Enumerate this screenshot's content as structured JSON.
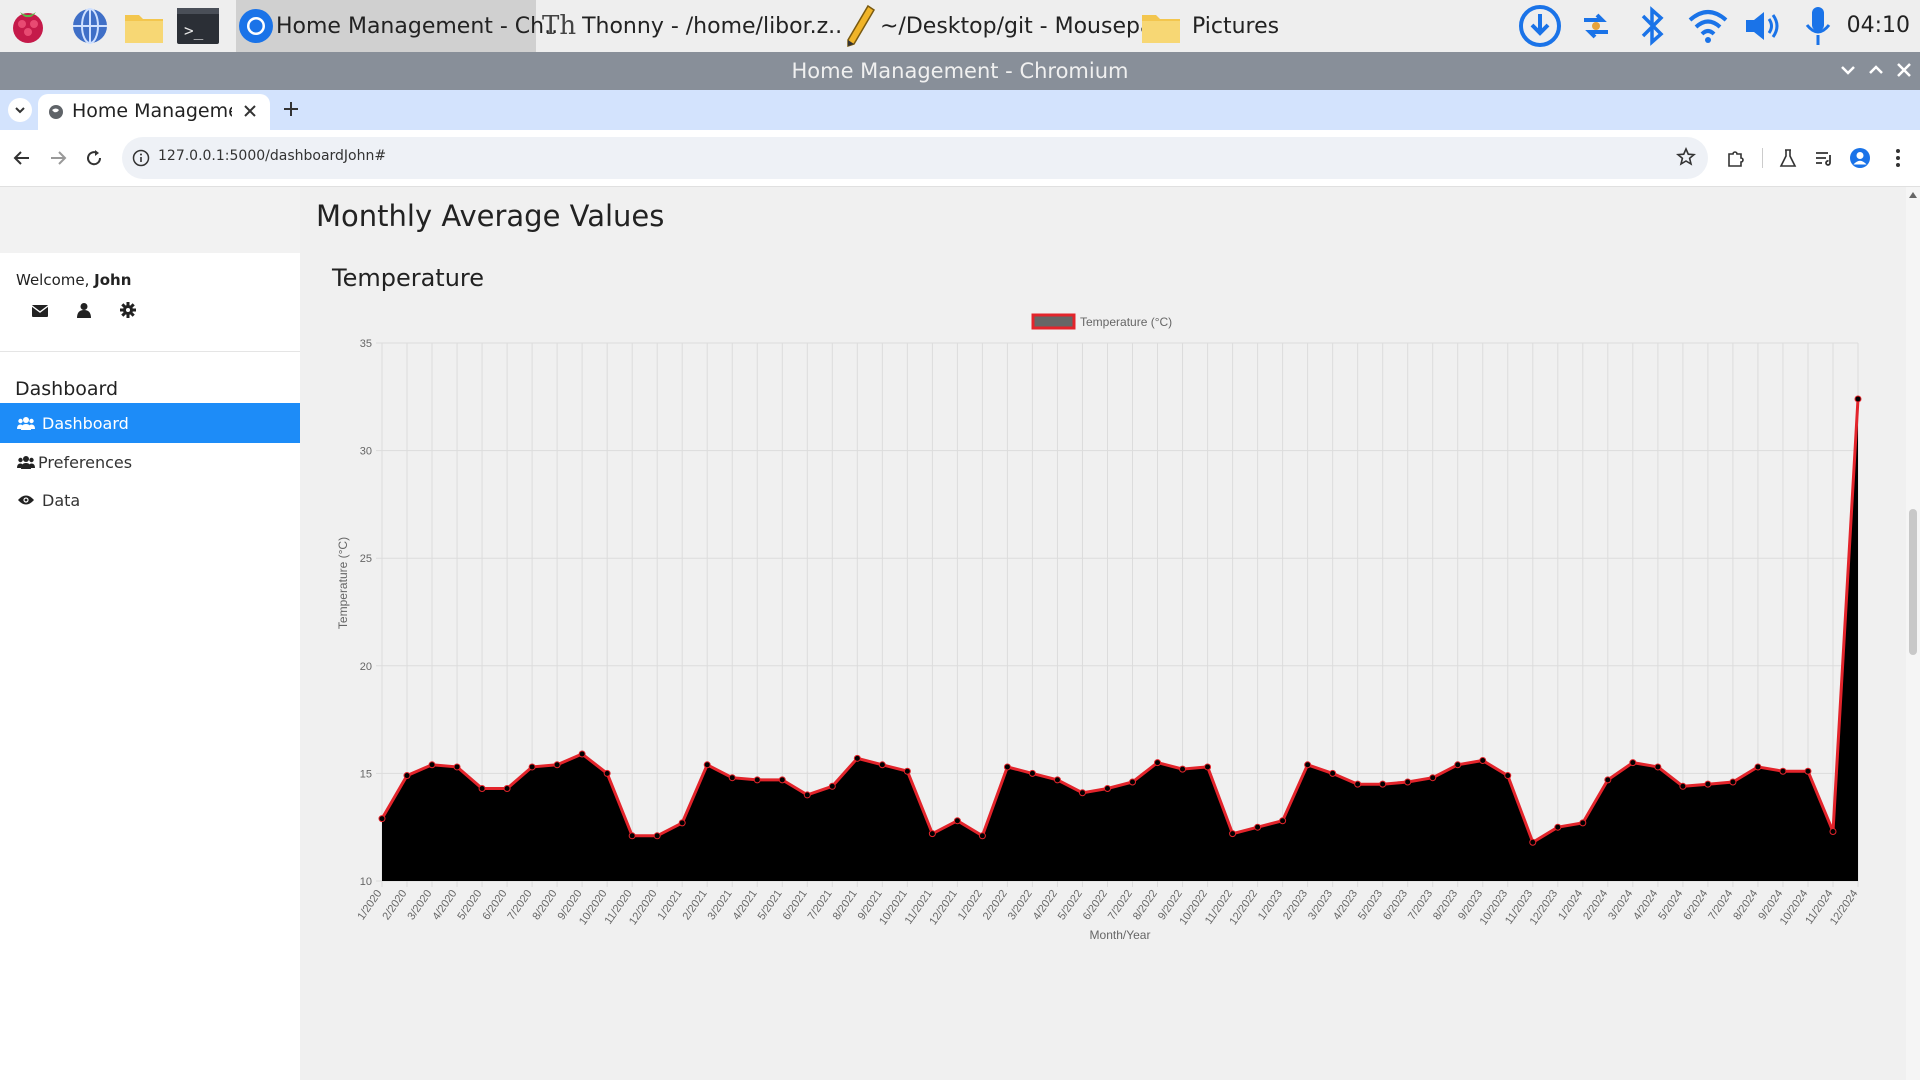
{
  "taskbar": {
    "items": [
      {
        "label": "Home Management - Ch..",
        "icon": "chromium-icon"
      },
      {
        "label": "Thonny  -  /home/libor.z..",
        "icon": "thonny-icon"
      },
      {
        "label": "~/Desktop/git - Mousepa..",
        "icon": "pencil-icon"
      },
      {
        "label": "Pictures",
        "icon": "folder-icon"
      }
    ],
    "clock": "04:10"
  },
  "window": {
    "title": "Home Management - Chromium"
  },
  "browser": {
    "tab_title": "Home Management",
    "url": "127.0.0.1:5000/dashboardJohn#"
  },
  "sidebar": {
    "welcome_prefix": "Welcome,",
    "user_name": "John",
    "section_title": "Dashboard",
    "items": [
      {
        "label": "Dashboard",
        "icon": "users-icon",
        "active": true
      },
      {
        "label": "Preferences",
        "icon": "users-icon",
        "active": false
      },
      {
        "label": "Data",
        "icon": "eye-icon",
        "active": false
      }
    ]
  },
  "main": {
    "page_title": "Monthly Average Values",
    "card_title": "Temperature"
  },
  "chart_data": {
    "type": "area",
    "title": "",
    "legend": "Temperature (°C)",
    "legend_position": "top-center",
    "xlabel": "Month/Year",
    "ylabel": "Temperature (°C)",
    "ylim": [
      10,
      35
    ],
    "yticks": [
      10,
      15,
      20,
      25,
      30,
      35
    ],
    "grid": true,
    "line_color": "#e3242b",
    "fill_color": "#000000",
    "categories": [
      "1/2020",
      "2/2020",
      "3/2020",
      "4/2020",
      "5/2020",
      "6/2020",
      "7/2020",
      "8/2020",
      "9/2020",
      "10/2020",
      "11/2020",
      "12/2020",
      "1/2021",
      "2/2021",
      "3/2021",
      "4/2021",
      "5/2021",
      "6/2021",
      "7/2021",
      "8/2021",
      "9/2021",
      "10/2021",
      "11/2021",
      "12/2021",
      "1/2022",
      "2/2022",
      "3/2022",
      "4/2022",
      "5/2022",
      "6/2022",
      "7/2022",
      "8/2022",
      "9/2022",
      "10/2022",
      "11/2022",
      "12/2022",
      "1/2023",
      "2/2023",
      "3/2023",
      "4/2023",
      "5/2023",
      "6/2023",
      "7/2023",
      "8/2023",
      "9/2023",
      "10/2023",
      "11/2023",
      "12/2023",
      "1/2024",
      "2/2024",
      "3/2024",
      "4/2024",
      "5/2024",
      "6/2024",
      "7/2024",
      "8/2024",
      "9/2024",
      "10/2024",
      "11/2024",
      "12/2024"
    ],
    "series": [
      {
        "name": "Temperature (°C)",
        "values": [
          12.9,
          14.9,
          15.4,
          15.3,
          14.3,
          14.3,
          15.3,
          15.4,
          15.9,
          15.0,
          12.1,
          12.1,
          12.7,
          15.4,
          14.8,
          14.7,
          14.7,
          14.0,
          14.4,
          15.7,
          15.4,
          15.1,
          12.2,
          12.8,
          12.1,
          15.3,
          15.0,
          14.7,
          14.1,
          14.3,
          14.6,
          15.5,
          15.2,
          15.3,
          12.2,
          12.5,
          12.8,
          15.4,
          15.0,
          14.5,
          14.5,
          14.6,
          14.8,
          15.4,
          15.6,
          14.9,
          11.8,
          12.5,
          12.7,
          14.7,
          15.5,
          15.3,
          14.4,
          14.5,
          14.6,
          15.3,
          15.1,
          15.1,
          12.3,
          32.4
        ]
      }
    ]
  }
}
